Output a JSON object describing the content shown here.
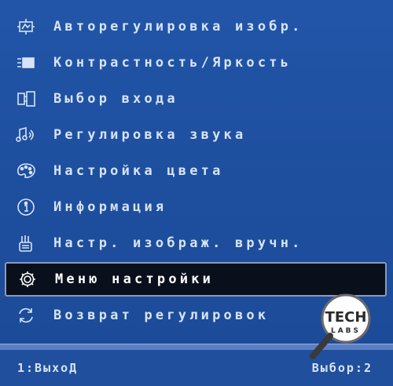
{
  "menu": {
    "items": [
      {
        "label": "Авторегулировка изобр.",
        "icon": "auto-adjust-icon"
      },
      {
        "label": "Контрастность/Яркость",
        "icon": "contrast-brightness-icon"
      },
      {
        "label": "Выбор входа",
        "icon": "input-select-icon"
      },
      {
        "label": "Регулировка звука",
        "icon": "audio-icon"
      },
      {
        "label": "Настройка цвета",
        "icon": "color-palette-icon"
      },
      {
        "label": "Информация",
        "icon": "info-icon"
      },
      {
        "label": "Настр. изображ. вручн.",
        "icon": "manual-image-icon"
      },
      {
        "label": "Меню настройки",
        "icon": "gear-icon",
        "selected": true
      },
      {
        "label": "Возврат регулировок",
        "icon": "reset-icon"
      }
    ]
  },
  "footer": {
    "exit_label": "1:ВыхоД",
    "select_label": "Выбор:2"
  },
  "watermark": {
    "line1": "TECH",
    "line2": "LABS"
  },
  "colors": {
    "background": "#1d4d9c",
    "text": "#d7e3f4",
    "selected_bg": "#0a0f1c"
  }
}
